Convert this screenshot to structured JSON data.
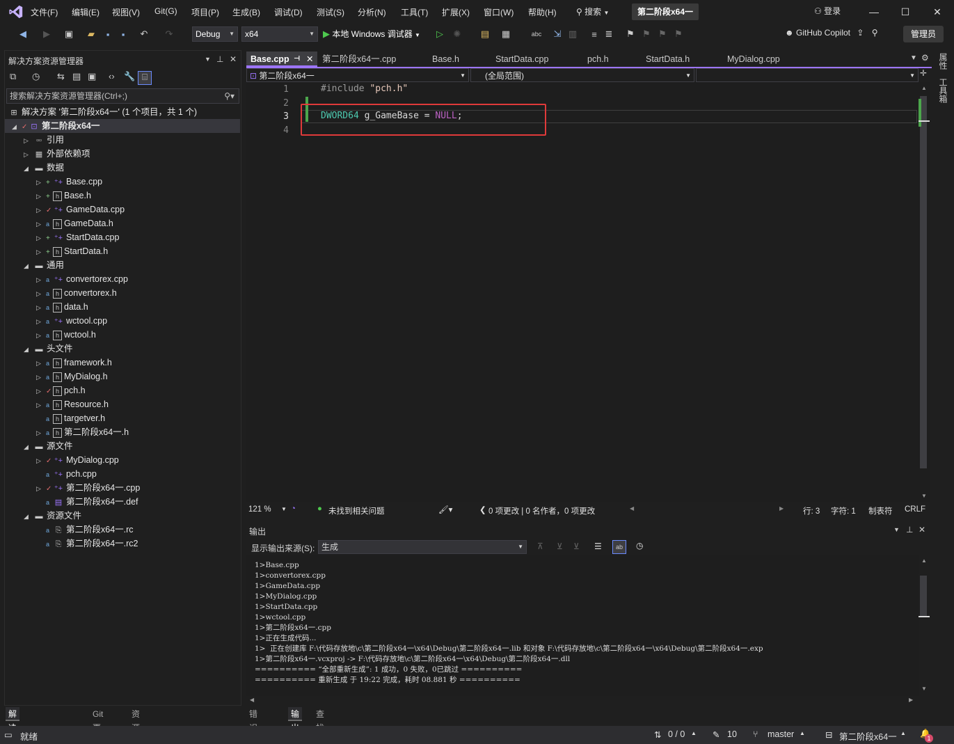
{
  "menu": [
    "文件(F)",
    "编辑(E)",
    "视图(V)",
    "Git(G)",
    "项目(P)",
    "生成(B)",
    "调试(D)",
    "测试(S)",
    "分析(N)",
    "工具(T)",
    "扩展(X)",
    "窗口(W)",
    "帮助(H)"
  ],
  "search_label": "搜索",
  "project_title": "第二阶段x64一",
  "login_label": "登录",
  "toolbar": {
    "config": "Debug",
    "platform": "x64",
    "run_label": "本地 Windows 调试器",
    "copilot": "GitHub Copilot",
    "admin": "管理员"
  },
  "solution": {
    "header": "解决方案资源管理器",
    "search_placeholder": "搜索解决方案资源管理器(Ctrl+;)",
    "root": "解决方案 '第二阶段x64一' (1 个项目，共 1 个)",
    "project": "第二阶段x64一",
    "items": [
      {
        "label": "引用",
        "level": 2,
        "arrow": "▷"
      },
      {
        "label": "外部依赖项",
        "level": 2,
        "arrow": "▷"
      },
      {
        "label": "数据",
        "level": 2,
        "arrow": "◢"
      },
      {
        "label": "Base.cpp",
        "level": 3,
        "arrow": "▷",
        "mark": "+"
      },
      {
        "label": "Base.h",
        "level": 3,
        "arrow": "▷",
        "mark": "+"
      },
      {
        "label": "GameData.cpp",
        "level": 3,
        "arrow": "▷",
        "mark": "✓"
      },
      {
        "label": "GameData.h",
        "level": 3,
        "arrow": "▷",
        "mark": "🔒"
      },
      {
        "label": "StartData.cpp",
        "level": 3,
        "arrow": "▷",
        "mark": "+"
      },
      {
        "label": "StartData.h",
        "level": 3,
        "arrow": "▷",
        "mark": "+"
      },
      {
        "label": "通用",
        "level": 2,
        "arrow": "◢"
      },
      {
        "label": "convertorex.cpp",
        "level": 3,
        "arrow": "▷",
        "mark": "🔒"
      },
      {
        "label": "convertorex.h",
        "level": 3,
        "arrow": "▷",
        "mark": "🔒"
      },
      {
        "label": "data.h",
        "level": 3,
        "arrow": "▷",
        "mark": "🔒"
      },
      {
        "label": "wctool.cpp",
        "level": 3,
        "arrow": "▷",
        "mark": "🔒"
      },
      {
        "label": "wctool.h",
        "level": 3,
        "arrow": "▷",
        "mark": "🔒"
      },
      {
        "label": "头文件",
        "level": 2,
        "arrow": "◢"
      },
      {
        "label": "framework.h",
        "level": 3,
        "arrow": "▷",
        "mark": "🔒"
      },
      {
        "label": "MyDialog.h",
        "level": 3,
        "arrow": "▷",
        "mark": "🔒"
      },
      {
        "label": "pch.h",
        "level": 3,
        "arrow": "▷",
        "mark": "✓"
      },
      {
        "label": "Resource.h",
        "level": 3,
        "arrow": "▷",
        "mark": "🔒"
      },
      {
        "label": "targetver.h",
        "level": 3,
        "arrow": "",
        "mark": "🔒"
      },
      {
        "label": "第二阶段x64一.h",
        "level": 3,
        "arrow": "▷",
        "mark": "🔒"
      },
      {
        "label": "源文件",
        "level": 2,
        "arrow": "◢"
      },
      {
        "label": "MyDialog.cpp",
        "level": 3,
        "arrow": "▷",
        "mark": "✓"
      },
      {
        "label": "pch.cpp",
        "level": 3,
        "arrow": "",
        "mark": "🔒"
      },
      {
        "label": "第二阶段x64一.cpp",
        "level": 3,
        "arrow": "▷",
        "mark": "✓"
      },
      {
        "label": "第二阶段x64一.def",
        "level": 3,
        "arrow": "",
        "mark": "🔒"
      },
      {
        "label": "资源文件",
        "level": 2,
        "arrow": "◢"
      },
      {
        "label": "第二阶段x64一.rc",
        "level": 3,
        "arrow": "",
        "mark": "🔒"
      },
      {
        "label": "第二阶段x64一.rc2",
        "level": 3,
        "arrow": "",
        "mark": "🔒"
      }
    ],
    "bottom_tabs": [
      "解决方案资源管理器",
      "Git 更改",
      "资源视图"
    ]
  },
  "editor": {
    "tabs": [
      "Base.cpp",
      "第二阶段x64一.cpp",
      "Base.h",
      "StartData.cpp",
      "pch.h",
      "StartData.h",
      "MyDialog.cpp"
    ],
    "nav_project": "第二阶段x64一",
    "nav_scope": "(全局范围)",
    "lines": [
      "1",
      "2",
      "3",
      "4"
    ],
    "code_include": "#include",
    "code_include_file": "\"pch.h\"",
    "code_type": "DWORD64",
    "code_var": " g_GameBase = ",
    "code_null": "NULL",
    "code_semi": ";",
    "zoom": "121 %",
    "issues": "未找到相关问题",
    "changes": "0 项更改 | 0 名作者，0 项更改",
    "line": "行: 3",
    "col": "字符: 1",
    "tabs_mode": "制表符",
    "eol": "CRLF"
  },
  "output": {
    "title": "输出",
    "source_label": "显示输出来源(S):",
    "source_value": "生成",
    "lines": [
      "1>Base.cpp",
      "1>convertorex.cpp",
      "1>GameData.cpp",
      "1>MyDialog.cpp",
      "1>StartData.cpp",
      "1>wctool.cpp",
      "1>第二阶段x64一.cpp",
      "1>正在生成代码...",
      "1>  正在创建库 F:\\代码存放地\\c\\第二阶段x64一\\x64\\Debug\\第二阶段x64一.lib 和对象 F:\\代码存放地\\c\\第二阶段x64一\\x64\\Debug\\第二阶段x64一.exp",
      "1>第二阶段x64一.vcxproj -> F:\\代码存放地\\c\\第二阶段x64一\\x64\\Debug\\第二阶段x64一.dll",
      "========== “全部重新生成”: 1 成功，0 失败，0已跳过 ==========",
      "========== 重新生成 于 19:22 完成，耗时 08.881 秒 =========="
    ],
    "tabs": [
      "错误列表",
      "输出",
      "查找符号结果"
    ]
  },
  "statusbar": {
    "ready": "就绪",
    "sync": "0 / 0",
    "edits": "10",
    "branch": "master",
    "repo": "第二阶段x64一",
    "notif": "1"
  },
  "side_tabs": [
    "属性",
    "工具箱"
  ]
}
